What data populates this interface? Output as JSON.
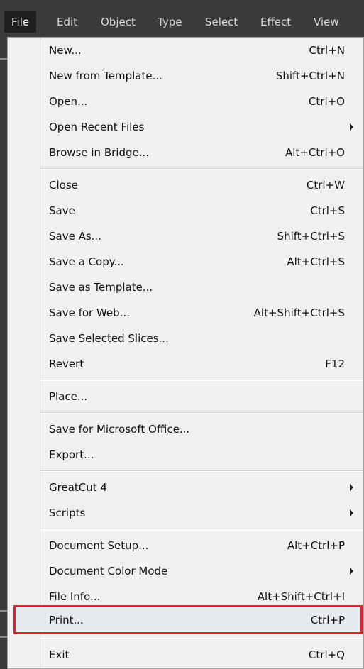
{
  "menubar": {
    "items": [
      {
        "label": "File"
      },
      {
        "label": "Edit"
      },
      {
        "label": "Object"
      },
      {
        "label": "Type"
      },
      {
        "label": "Select"
      },
      {
        "label": "Effect"
      },
      {
        "label": "View"
      }
    ]
  },
  "file_menu": {
    "items": [
      {
        "label": "New...",
        "shortcut": "Ctrl+N"
      },
      {
        "label": "New from Template...",
        "shortcut": "Shift+Ctrl+N"
      },
      {
        "label": "Open...",
        "shortcut": "Ctrl+O"
      },
      {
        "label": "Open Recent Files",
        "submenu": true
      },
      {
        "label": "Browse in Bridge...",
        "shortcut": "Alt+Ctrl+O"
      },
      {
        "label": "Close",
        "shortcut": "Ctrl+W"
      },
      {
        "label": "Save",
        "shortcut": "Ctrl+S"
      },
      {
        "label": "Save As...",
        "shortcut": "Shift+Ctrl+S"
      },
      {
        "label": "Save a Copy...",
        "shortcut": "Alt+Ctrl+S"
      },
      {
        "label": "Save as Template..."
      },
      {
        "label": "Save for Web...",
        "shortcut": "Alt+Shift+Ctrl+S"
      },
      {
        "label": "Save Selected Slices..."
      },
      {
        "label": "Revert",
        "shortcut": "F12"
      },
      {
        "label": "Place..."
      },
      {
        "label": "Save for Microsoft Office..."
      },
      {
        "label": "Export..."
      },
      {
        "label": "GreatCut 4",
        "submenu": true
      },
      {
        "label": "Scripts",
        "submenu": true
      },
      {
        "label": "Document Setup...",
        "shortcut": "Alt+Ctrl+P"
      },
      {
        "label": "Document Color Mode",
        "submenu": true
      },
      {
        "label": "File Info...",
        "shortcut": "Alt+Shift+Ctrl+I"
      },
      {
        "label": "Print...",
        "shortcut": "Ctrl+P",
        "highlighted": true
      },
      {
        "label": "Exit",
        "shortcut": "Ctrl+Q"
      }
    ]
  },
  "colors": {
    "highlight_border": "#e2232f",
    "menu_background": "#f0f0f0",
    "menubar_background": "#3b3b3b"
  }
}
